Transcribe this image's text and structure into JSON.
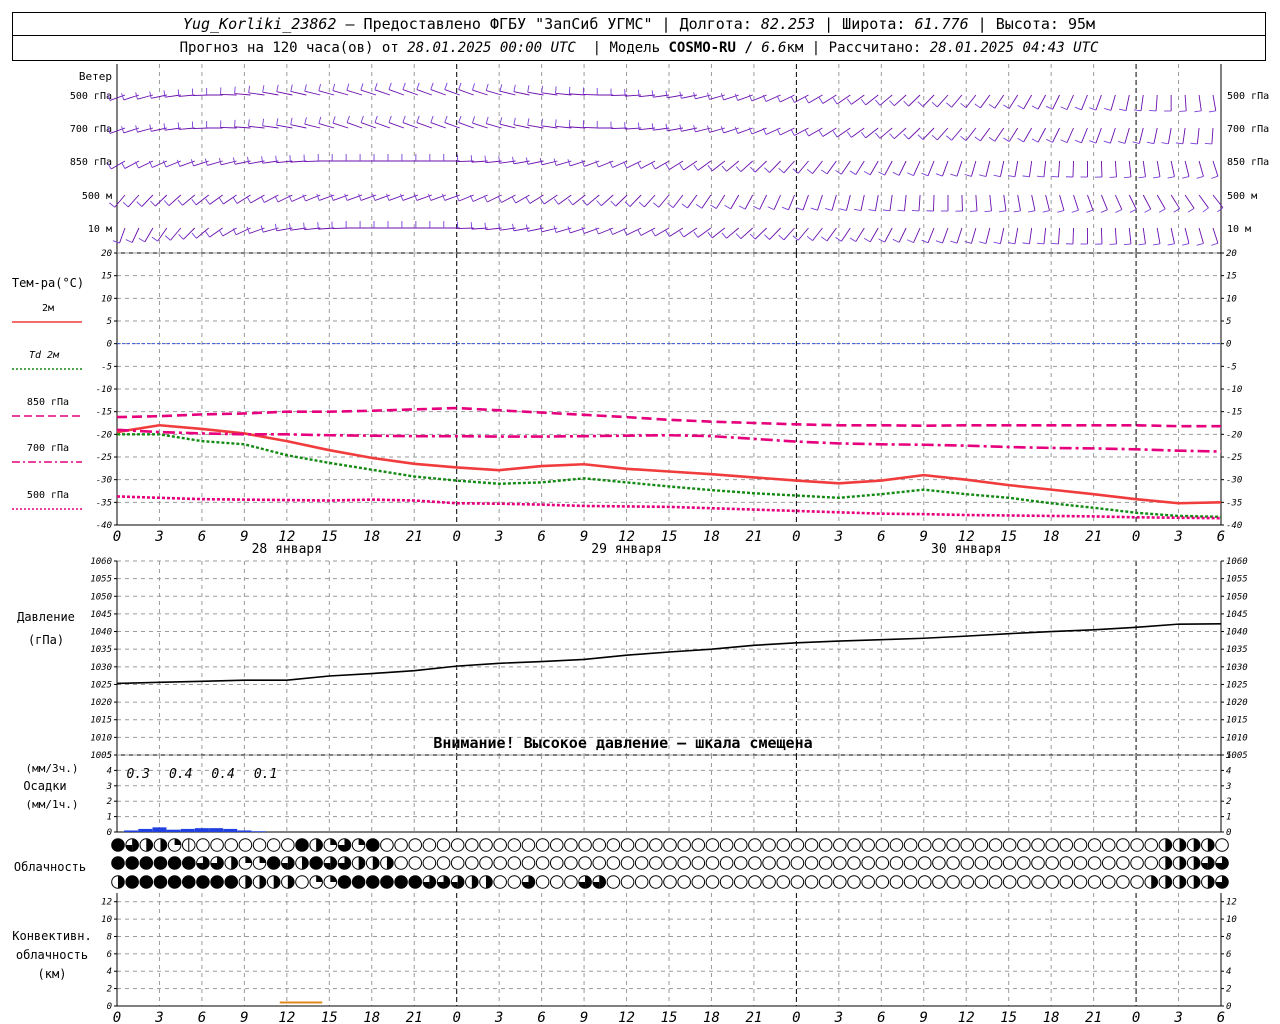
{
  "header": {
    "station": "Yug_Korliki_23862",
    "provider": " – Предоставлено ФГБУ \"ЗапСиб УГМС\" | Долгота: ",
    "lon": "82.253",
    "lat_label": " | Широта: ",
    "lat": "61.776",
    "alt_label": " | Высота: 95м",
    "forecast_label": "Прогноз на 120 часа(ов) от ",
    "forecast_date": "28.01.2025 00:00 UTC",
    "model_label": "  | Модель ",
    "model": "COSMO-RU / ",
    "resolution": "6.6",
    "res_unit": "км | Рассчитано: ",
    "calc_date": "28.01.2025 04:43 UTC"
  },
  "labels": {
    "wind_title": "Ветер",
    "wind_levels": [
      "500 гПа",
      "700 гПа",
      "850 гПа",
      "500 м",
      "10  м"
    ],
    "temp_title": "Тем-ра(°С)",
    "temp_legend": [
      {
        "label": "2м",
        "color": "#f03c3c",
        "dash": ""
      },
      {
        "label": "Td  2м",
        "color": "#138a13",
        "dash": "2,2"
      },
      {
        "label": "850 гПа",
        "color": "#e6007e",
        "dash": "8,4"
      },
      {
        "label": "700 гПа",
        "color": "#e6007e",
        "dash": "8,3,2,3"
      },
      {
        "label": "500 гПа",
        "color": "#e6007e",
        "dash": "2,2"
      }
    ],
    "pressure_title": "Давление",
    "pressure_unit": "(гПа)",
    "pressure_warning": "Внимание! Высокое давление – шкала смещена",
    "precip_unit3": "(мм/3ч.)",
    "precip_title": "Осадки",
    "precip_unit1": "(мм/1ч.)",
    "cloud_title": "Облачность",
    "conv_title1": "Конвективн.",
    "conv_title2": "облачность",
    "conv_unit": "(км)",
    "day_labels": [
      "28 января",
      "29 января",
      "30 января"
    ]
  },
  "chart_data": {
    "type": "line",
    "hours": [
      0,
      3,
      6,
      9,
      12,
      15,
      18,
      21,
      0,
      3,
      6,
      9,
      12,
      15,
      18,
      21,
      0,
      3,
      6,
      9,
      12,
      15,
      18,
      21,
      0,
      3,
      6
    ],
    "temperature": {
      "ylim": [
        -40,
        20
      ],
      "ticks": [
        20,
        15,
        10,
        5,
        0,
        -5,
        -10,
        -15,
        -20,
        -25,
        -30,
        -35,
        -40
      ],
      "x": [
        0,
        3,
        6,
        9,
        12,
        15,
        18,
        21,
        24,
        27,
        30,
        33,
        36,
        39,
        42,
        45,
        48,
        51,
        54,
        57,
        60,
        63,
        66,
        69,
        72,
        75,
        78
      ],
      "series": [
        {
          "name": "2м",
          "color": "#f03c3c",
          "width": 2.6,
          "dash": "",
          "values": [
            -19.5,
            -18,
            -18.8,
            -19.8,
            -21.5,
            -23.5,
            -25.2,
            -26.5,
            -27.3,
            -27.9,
            -27,
            -26.6,
            -27.6,
            -28.2,
            -28.8,
            -29.5,
            -30.2,
            -30.8,
            -30.2,
            -29,
            -30,
            -31.2,
            -32.2,
            -33.2,
            -34.3,
            -35.2,
            -35
          ]
        },
        {
          "name": "Td  2м",
          "color": "#138a13",
          "width": 2.4,
          "dash": "3,2",
          "values": [
            -20,
            -20,
            -21.5,
            -22.2,
            -24.6,
            -26.3,
            -27.8,
            -29.3,
            -30.2,
            -30.9,
            -30.6,
            -29.7,
            -30.6,
            -31.5,
            -32.3,
            -33,
            -33.5,
            -34,
            -33.2,
            -32.2,
            -33.2,
            -34,
            -35.2,
            -36.2,
            -37.3,
            -38,
            -38.2
          ]
        },
        {
          "name": "850 гПа",
          "color": "#e6007e",
          "width": 2.6,
          "dash": "10,5",
          "values": [
            -16.2,
            -16,
            -15.6,
            -15.4,
            -15,
            -15,
            -14.8,
            -14.5,
            -14.2,
            -14.7,
            -15.2,
            -15.7,
            -16.2,
            -16.8,
            -17.2,
            -17.5,
            -17.8,
            -18,
            -18,
            -18.1,
            -18,
            -18,
            -18,
            -18,
            -18,
            -18.2,
            -18.2
          ]
        },
        {
          "name": "700 гПа",
          "color": "#e6007e",
          "width": 2.6,
          "dash": "12,4,3,4",
          "values": [
            -19,
            -19.5,
            -19.8,
            -20,
            -20,
            -20.2,
            -20.3,
            -20.4,
            -20.4,
            -20.5,
            -20.5,
            -20.4,
            -20.3,
            -20.2,
            -20.4,
            -21,
            -21.6,
            -22,
            -22.2,
            -22.3,
            -22.5,
            -22.8,
            -23,
            -23.1,
            -23.3,
            -23.6,
            -23.8
          ]
        },
        {
          "name": "500 гПа",
          "color": "#e6007e",
          "width": 2.6,
          "dash": "3,2",
          "values": [
            -33.7,
            -34,
            -34.3,
            -34.4,
            -34.5,
            -34.6,
            -34.4,
            -34.6,
            -35.2,
            -35.3,
            -35.5,
            -35.8,
            -35.9,
            -36,
            -36.3,
            -36.6,
            -36.9,
            -37.2,
            -37.5,
            -37.6,
            -37.8,
            -37.9,
            -38,
            -38.1,
            -38.3,
            -38.4,
            -38.5
          ]
        }
      ]
    },
    "pressure": {
      "ylim": [
        1005,
        1060
      ],
      "ticks": [
        1060,
        1055,
        1050,
        1045,
        1040,
        1035,
        1030,
        1025,
        1020,
        1015,
        1010,
        1005
      ],
      "x": [
        0,
        3,
        6,
        9,
        12,
        15,
        18,
        21,
        24,
        27,
        30,
        33,
        36,
        39,
        42,
        45,
        48,
        51,
        54,
        57,
        60,
        63,
        66,
        69,
        72,
        75,
        78
      ],
      "values": [
        1025.3,
        1025.6,
        1025.9,
        1026.2,
        1026.2,
        1027.4,
        1028.1,
        1028.9,
        1030.2,
        1031,
        1031.5,
        1032.1,
        1033.3,
        1034.2,
        1035,
        1036.1,
        1036.8,
        1037.3,
        1037.7,
        1038.1,
        1038.7,
        1039.4,
        1040,
        1040.5,
        1041.2,
        1042.1,
        1042.2
      ]
    },
    "precipitation": {
      "ylim": [
        0,
        5
      ],
      "ticks": [
        5,
        4,
        3,
        2,
        1,
        0
      ],
      "x": [
        1,
        2,
        3,
        4,
        5,
        6,
        7,
        8,
        9,
        10
      ],
      "values": [
        0.1,
        0.2,
        0.3,
        0.15,
        0.2,
        0.25,
        0.25,
        0.2,
        0.1,
        0.05
      ],
      "labels_3h": [
        {
          "x": 1.5,
          "text": "0.3"
        },
        {
          "x": 4.5,
          "text": "0.4"
        },
        {
          "x": 7.5,
          "text": "0.4"
        },
        {
          "x": 10.5,
          "text": "0.1"
        }
      ]
    },
    "cloudiness": {
      "x": [
        0,
        1,
        2,
        3,
        4,
        5,
        6,
        7,
        8,
        9,
        10,
        11,
        12,
        13,
        14,
        15,
        16,
        17,
        18,
        19,
        20,
        21,
        22,
        23,
        24,
        25,
        26,
        27,
        28,
        29,
        30,
        31,
        32,
        33,
        34,
        35,
        36,
        37,
        38,
        39,
        40,
        41,
        42,
        43,
        44,
        45,
        46,
        47,
        48,
        49,
        50,
        51,
        52,
        53,
        54,
        55,
        56,
        57,
        58,
        59,
        60,
        61,
        62,
        63,
        64,
        65,
        66,
        67,
        68,
        69,
        70,
        71,
        72,
        73,
        74,
        75,
        76,
        77,
        78
      ],
      "high": [
        8,
        6,
        5,
        4,
        2,
        1,
        0,
        0,
        0,
        0,
        0,
        0,
        0,
        8,
        5,
        2,
        6,
        2,
        8,
        0,
        0,
        0,
        0,
        0,
        0,
        0,
        0,
        0,
        0,
        0,
        0,
        0,
        0,
        0,
        0,
        0,
        0,
        0,
        0,
        0,
        0,
        0,
        0,
        0,
        0,
        0,
        0,
        0,
        0,
        0,
        0,
        0,
        0,
        0,
        0,
        0,
        0,
        0,
        0,
        0,
        0,
        0,
        0,
        0,
        0,
        0,
        0,
        0,
        0,
        0,
        0,
        0,
        0,
        0,
        4,
        4,
        4,
        4,
        0
      ],
      "middle": [
        8,
        8,
        8,
        8,
        8,
        8,
        6,
        6,
        5,
        2,
        2,
        8,
        6,
        5,
        8,
        6,
        6,
        4,
        4,
        4,
        0,
        0,
        0,
        0,
        0,
        0,
        0,
        0,
        0,
        0,
        0,
        0,
        0,
        0,
        0,
        0,
        0,
        0,
        0,
        0,
        0,
        0,
        0,
        0,
        0,
        0,
        0,
        0,
        0,
        0,
        0,
        0,
        0,
        0,
        0,
        0,
        0,
        0,
        0,
        0,
        0,
        0,
        0,
        0,
        0,
        0,
        0,
        0,
        0,
        0,
        0,
        0,
        0,
        0,
        4,
        4,
        4,
        6,
        6
      ],
      "low": [
        4,
        8,
        8,
        8,
        8,
        8,
        8,
        8,
        8,
        4,
        4,
        4,
        4,
        0,
        2,
        2,
        8,
        8,
        8,
        8,
        8,
        8,
        6,
        6,
        6,
        5,
        4,
        0,
        0,
        6,
        0,
        0,
        0,
        6,
        6,
        0,
        0,
        0,
        0,
        0,
        0,
        0,
        0,
        0,
        0,
        0,
        0,
        0,
        0,
        0,
        0,
        0,
        0,
        0,
        0,
        0,
        0,
        0,
        0,
        0,
        0,
        0,
        0,
        0,
        0,
        0,
        0,
        0,
        0,
        0,
        0,
        0,
        0,
        4,
        4,
        4,
        4,
        4,
        6
      ]
    },
    "convective": {
      "ylim": [
        0,
        13
      ],
      "ticks": [
        12,
        10,
        8,
        6,
        4,
        2,
        0
      ],
      "segments": [
        {
          "x0": 11.5,
          "x1": 14.5,
          "base": 0,
          "top": 0.4,
          "color": "#e08a1e"
        }
      ]
    },
    "wind": {
      "levels": [
        "500 гПа",
        "700 гПа",
        "850 гПа",
        "500 м",
        "10  м"
      ],
      "x_step": 1,
      "dir_500hpa": [
        250,
        252,
        255,
        258,
        262,
        265,
        268,
        270,
        272,
        275,
        278,
        280,
        282,
        283,
        284,
        285,
        286,
        287,
        288,
        289,
        290,
        290,
        290,
        290,
        290,
        290,
        288,
        286,
        284,
        282,
        280,
        278,
        276,
        274,
        272,
        270,
        268,
        266,
        264,
        262,
        260,
        258,
        256,
        254,
        252,
        250,
        248,
        246,
        244,
        242,
        240,
        238,
        236,
        234,
        232,
        230,
        228,
        226,
        224,
        222,
        220,
        218,
        216,
        214,
        212,
        210,
        208,
        206,
        204,
        202,
        200,
        196,
        192,
        188,
        184,
        180,
        176,
        172,
        170
      ],
      "dir_700hpa": [
        250,
        252,
        255,
        258,
        262,
        265,
        268,
        270,
        272,
        274,
        276,
        278,
        280,
        282,
        284,
        286,
        288,
        290,
        290,
        290,
        290,
        290,
        290,
        290,
        290,
        290,
        288,
        286,
        284,
        282,
        280,
        278,
        276,
        274,
        272,
        270,
        268,
        266,
        264,
        262,
        260,
        258,
        256,
        254,
        252,
        250,
        248,
        246,
        244,
        242,
        240,
        238,
        236,
        234,
        232,
        230,
        228,
        226,
        224,
        222,
        220,
        218,
        216,
        214,
        212,
        210,
        208,
        206,
        204,
        202,
        200,
        198,
        196,
        194,
        192,
        190,
        188,
        186,
        184
      ],
      "dir_850hpa": [
        240,
        242,
        244,
        246,
        248,
        250,
        252,
        254,
        256,
        258,
        260,
        262,
        264,
        266,
        268,
        270,
        270,
        270,
        270,
        270,
        270,
        270,
        270,
        270,
        270,
        268,
        266,
        264,
        262,
        260,
        258,
        256,
        254,
        252,
        250,
        248,
        246,
        244,
        242,
        240,
        238,
        236,
        234,
        232,
        230,
        228,
        226,
        224,
        222,
        220,
        218,
        216,
        214,
        212,
        210,
        208,
        206,
        204,
        202,
        200,
        198,
        196,
        194,
        192,
        190,
        188,
        186,
        184,
        182,
        180,
        178,
        176,
        174,
        172,
        170,
        168,
        166,
        164,
        162
      ],
      "dir_500m": [
        220,
        222,
        224,
        226,
        228,
        230,
        232,
        234,
        236,
        238,
        240,
        242,
        244,
        246,
        248,
        250,
        250,
        250,
        250,
        250,
        250,
        250,
        250,
        250,
        250,
        248,
        246,
        244,
        242,
        240,
        238,
        236,
        234,
        232,
        230,
        228,
        226,
        224,
        222,
        220,
        218,
        216,
        214,
        212,
        210,
        208,
        206,
        204,
        202,
        200,
        198,
        196,
        194,
        192,
        190,
        188,
        186,
        184,
        182,
        180,
        178,
        176,
        174,
        172,
        170,
        168,
        166,
        164,
        162,
        160,
        158,
        156,
        154,
        152,
        150,
        148,
        146,
        144,
        142
      ],
      "dir_10m": [
        200,
        205,
        210,
        215,
        220,
        225,
        230,
        235,
        240,
        245,
        250,
        255,
        260,
        262,
        264,
        266,
        268,
        270,
        270,
        270,
        270,
        270,
        270,
        270,
        270,
        268,
        266,
        264,
        262,
        260,
        258,
        256,
        254,
        252,
        250,
        248,
        246,
        244,
        242,
        240,
        238,
        236,
        234,
        232,
        230,
        228,
        226,
        224,
        222,
        220,
        218,
        216,
        214,
        212,
        210,
        208,
        206,
        204,
        202,
        200,
        198,
        196,
        194,
        192,
        190,
        188,
        186,
        184,
        182,
        180,
        178,
        176,
        174,
        172,
        170,
        168,
        166,
        164,
        162
      ],
      "colors": {
        "barb": "#6a0dad",
        "thin": "#7a3fd6"
      }
    }
  }
}
